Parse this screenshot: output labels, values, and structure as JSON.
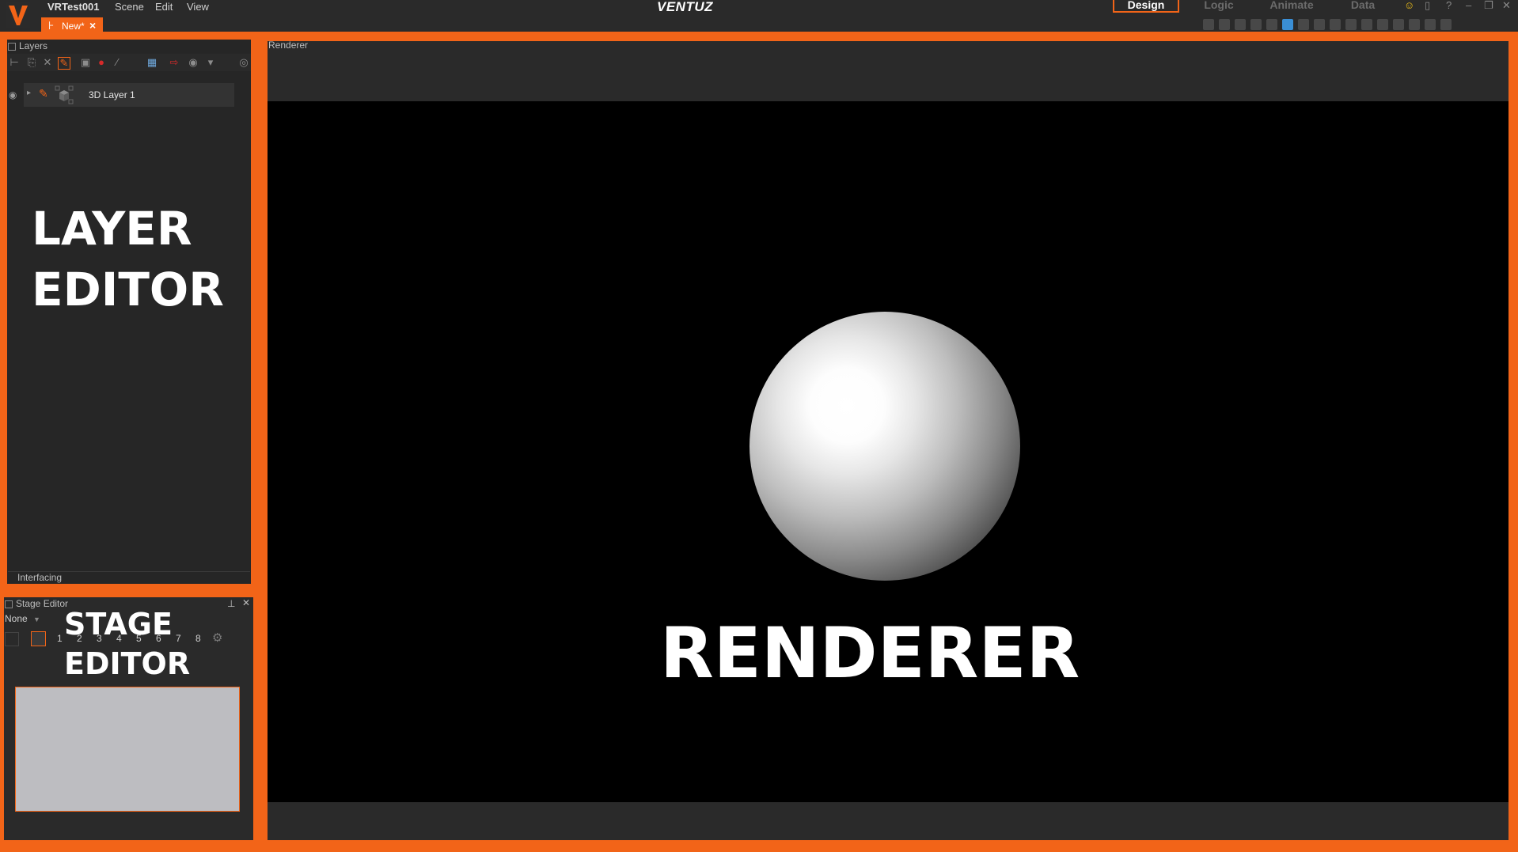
{
  "app": {
    "project_name": "VRTest001",
    "brand": "VENTUZ",
    "menu": [
      "Scene",
      "Edit",
      "View"
    ],
    "document_tab": {
      "label": "New*",
      "close_glyph": "×"
    }
  },
  "modes": {
    "items": [
      "Design",
      "Logic",
      "Animate",
      "Data"
    ],
    "active": "Design"
  },
  "layers": {
    "panel_title": "Layers",
    "rows": [
      {
        "label": "3D Layer 1"
      }
    ],
    "overlay_label_line1": "LAYER",
    "overlay_label_line2": "EDITOR",
    "interfacing_label": "Interfacing"
  },
  "stage": {
    "panel_title": "Stage Editor",
    "selector_value": "None",
    "numbers": [
      "1",
      "2",
      "3",
      "4",
      "5",
      "6",
      "7",
      "8"
    ],
    "overlay_label_line1": "STAGE",
    "overlay_label_line2": "EDITOR"
  },
  "renderer": {
    "panel_title": "Renderer",
    "overlay_label": "RENDERER"
  },
  "colors": {
    "accent": "#f26418",
    "background": "#262626",
    "viewport": "#000000"
  }
}
